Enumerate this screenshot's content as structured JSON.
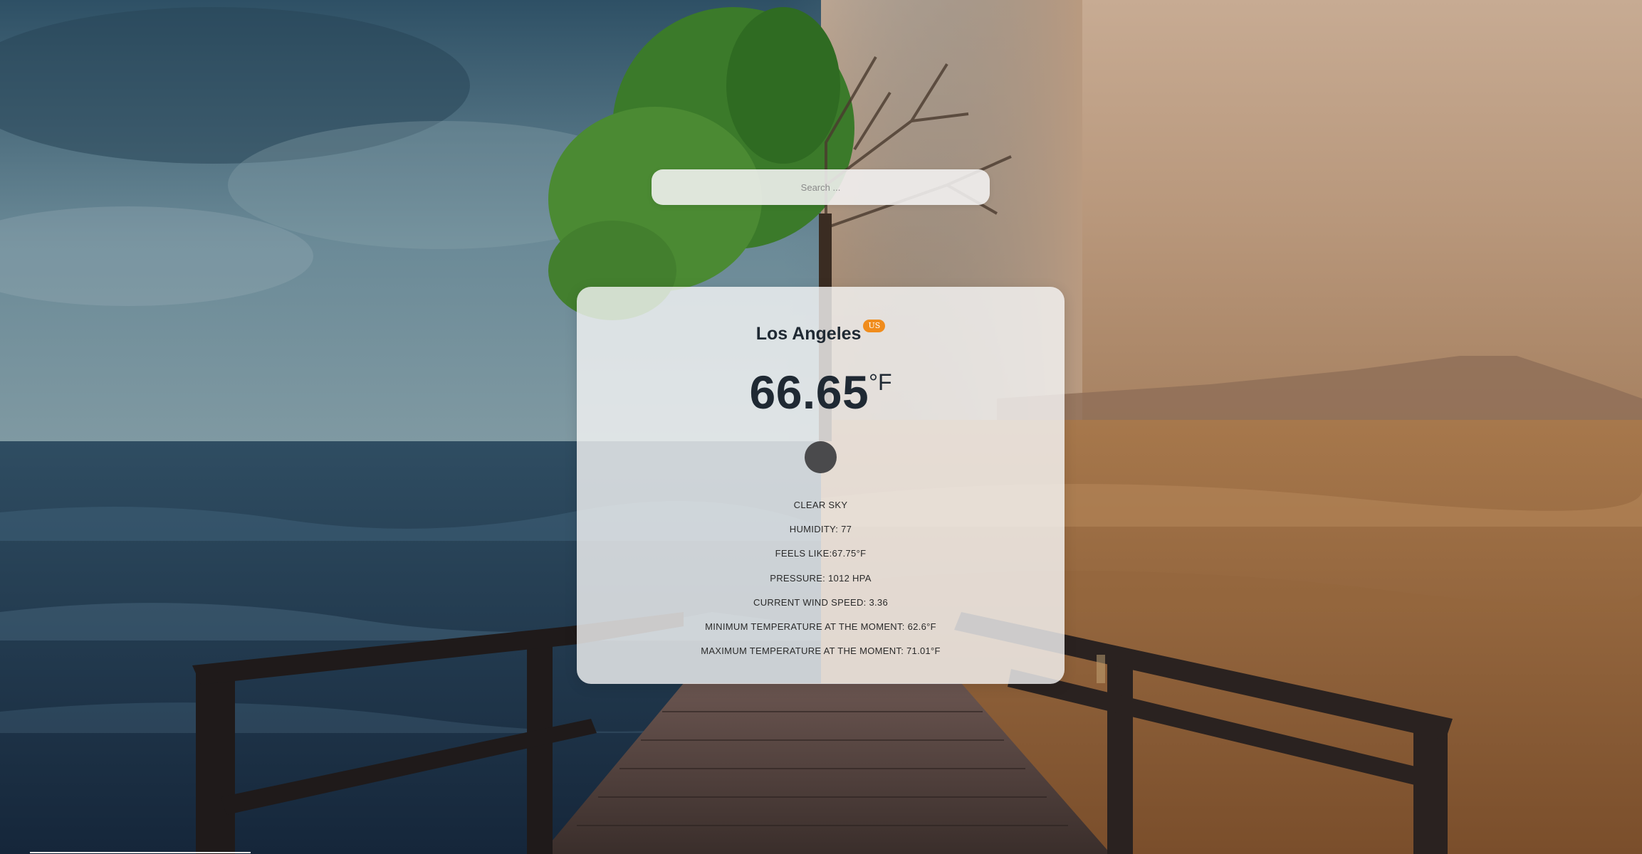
{
  "search": {
    "placeholder": "Search ..."
  },
  "weather": {
    "city": "Los Angeles",
    "country": "US",
    "temperature": "66.65",
    "unit": "°F",
    "icon": "weather-condition-icon",
    "description": "CLEAR SKY",
    "details": [
      "HUMIDITY: 77",
      "FEELS LIKE:67.75°F",
      "PRESSURE: 1012 HPA",
      "CURRENT WIND SPEED: 3.36",
      "MINIMUM TEMPERATURE AT THE MOMENT: 62.6°F",
      "MAXIMUM TEMPERATURE AT THE MOMENT: 71.01°F"
    ]
  },
  "colors": {
    "badge": "#f08c1c",
    "text": "#1f2933",
    "icon": "#4a4a4c"
  }
}
